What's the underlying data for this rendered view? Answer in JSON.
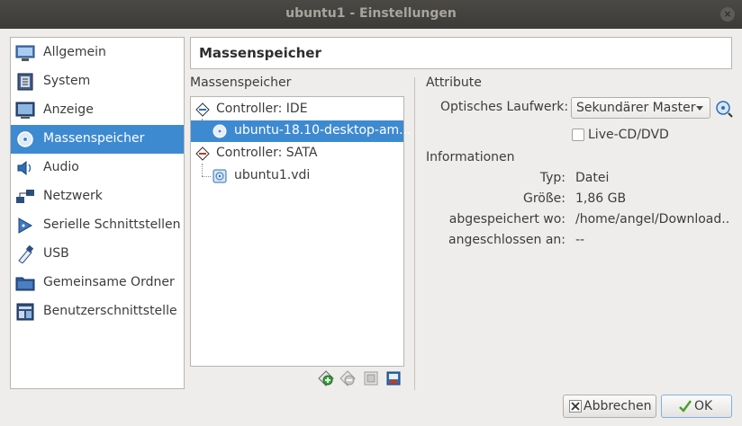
{
  "window": {
    "title": "ubuntu1 - Einstellungen",
    "close": "×"
  },
  "sidebar": {
    "items": [
      {
        "label": "Allgemein",
        "icon": "general-icon"
      },
      {
        "label": "System",
        "icon": "system-icon"
      },
      {
        "label": "Anzeige",
        "icon": "display-icon"
      },
      {
        "label": "Massenspeicher",
        "icon": "storage-icon",
        "active": true
      },
      {
        "label": "Audio",
        "icon": "audio-icon"
      },
      {
        "label": "Netzwerk",
        "icon": "network-icon"
      },
      {
        "label": "Serielle Schnittstellen",
        "icon": "serial-ports-icon"
      },
      {
        "label": "USB",
        "icon": "usb-icon"
      },
      {
        "label": "Gemeinsame Ordner",
        "icon": "shared-folders-icon"
      },
      {
        "label": "Benutzerschnittstelle",
        "icon": "user-interface-icon"
      }
    ]
  },
  "page": {
    "title": "Massenspeicher"
  },
  "storage": {
    "label": "Massenspeicher",
    "tree": [
      {
        "label": "Controller: IDE",
        "type": "controller"
      },
      {
        "label": "ubuntu-18.10-desktop-am...",
        "type": "optical",
        "selected": true
      },
      {
        "label": "Controller: SATA",
        "type": "controller"
      },
      {
        "label": "ubuntu1.vdi",
        "type": "disk"
      }
    ],
    "toolbar": [
      "add-attachment-icon",
      "remove-attachment-icon",
      "add-controller-icon",
      "remove-controller-icon"
    ]
  },
  "attributes": {
    "heading": "Attribute",
    "drive_label": "Optisches Laufwerk:",
    "drive_value": "Sekundärer Master",
    "live_cd_label": "Live-CD/DVD",
    "live_cd_checked": false
  },
  "info": {
    "heading": "Informationen",
    "rows": [
      {
        "key": "Typ:",
        "value": "Datei"
      },
      {
        "key": "Größe:",
        "value": "1,86 GB"
      },
      {
        "key": "abgespeichert wo:",
        "value": "/home/angel/Download.."
      },
      {
        "key": "angeschlossen an:",
        "value": "--"
      }
    ]
  },
  "buttons": {
    "cancel": "Abbrechen",
    "ok": "OK"
  },
  "colors": {
    "selection": "#3e8ad0",
    "titlebar": "#3c3b37"
  }
}
